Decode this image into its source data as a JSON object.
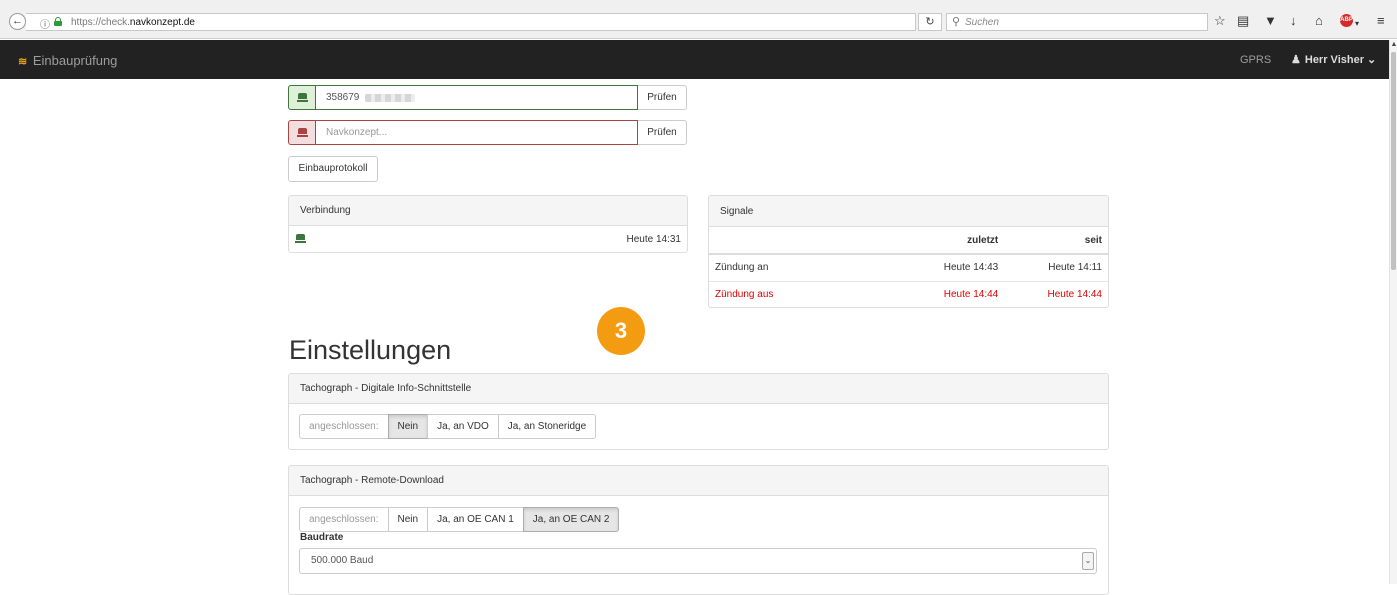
{
  "browser": {
    "url_prefix": "https://check.",
    "url_domain": "navkonzept.de",
    "search_placeholder": "Suchen",
    "abp_label": "ABP"
  },
  "navbar": {
    "brand": "Einbauprüfung",
    "gprs": "GPRS",
    "user": "Herr Visher"
  },
  "device_input": {
    "value": "358679",
    "button": "Prüfen"
  },
  "navkonzept_input": {
    "placeholder": "Navkonzept...",
    "button": "Prüfen"
  },
  "protokoll_button": "Einbauprotokoll",
  "verbindung": {
    "title": "Verbindung",
    "time": "Heute 14:31"
  },
  "signale": {
    "title": "Signale",
    "headers": {
      "name": "",
      "zuletzt": "zuletzt",
      "seit": "seit"
    },
    "rows": [
      {
        "name": "Zündung an",
        "zuletzt": "Heute 14:43",
        "seit": "Heute 14:11",
        "status": "ok"
      },
      {
        "name": "Zündung aus",
        "zuletzt": "Heute 14:44",
        "seit": "Heute 14:44",
        "status": "alert"
      }
    ]
  },
  "step_badge": "3",
  "settings": {
    "title": "Einstellungen",
    "dis": {
      "title": "Tachograph - Digitale Info-Schnittstelle",
      "label": "angeschlossen:",
      "options": [
        "Nein",
        "Ja, an VDO",
        "Ja, an Stoneridge"
      ],
      "selected": "Nein"
    },
    "remote": {
      "title": "Tachograph - Remote-Download",
      "label": "angeschlossen:",
      "options": [
        "Nein",
        "Ja, an OE CAN 1",
        "Ja, an OE CAN 2"
      ],
      "selected": "Ja, an OE CAN 2",
      "baud_label": "Baudrate",
      "baud_value": "500.000 Baud"
    }
  },
  "colors": {
    "navbar": "#222222",
    "success": "#3c763d",
    "danger": "#a94442",
    "alert_text": "#e00000",
    "badge": "#f39c12"
  }
}
